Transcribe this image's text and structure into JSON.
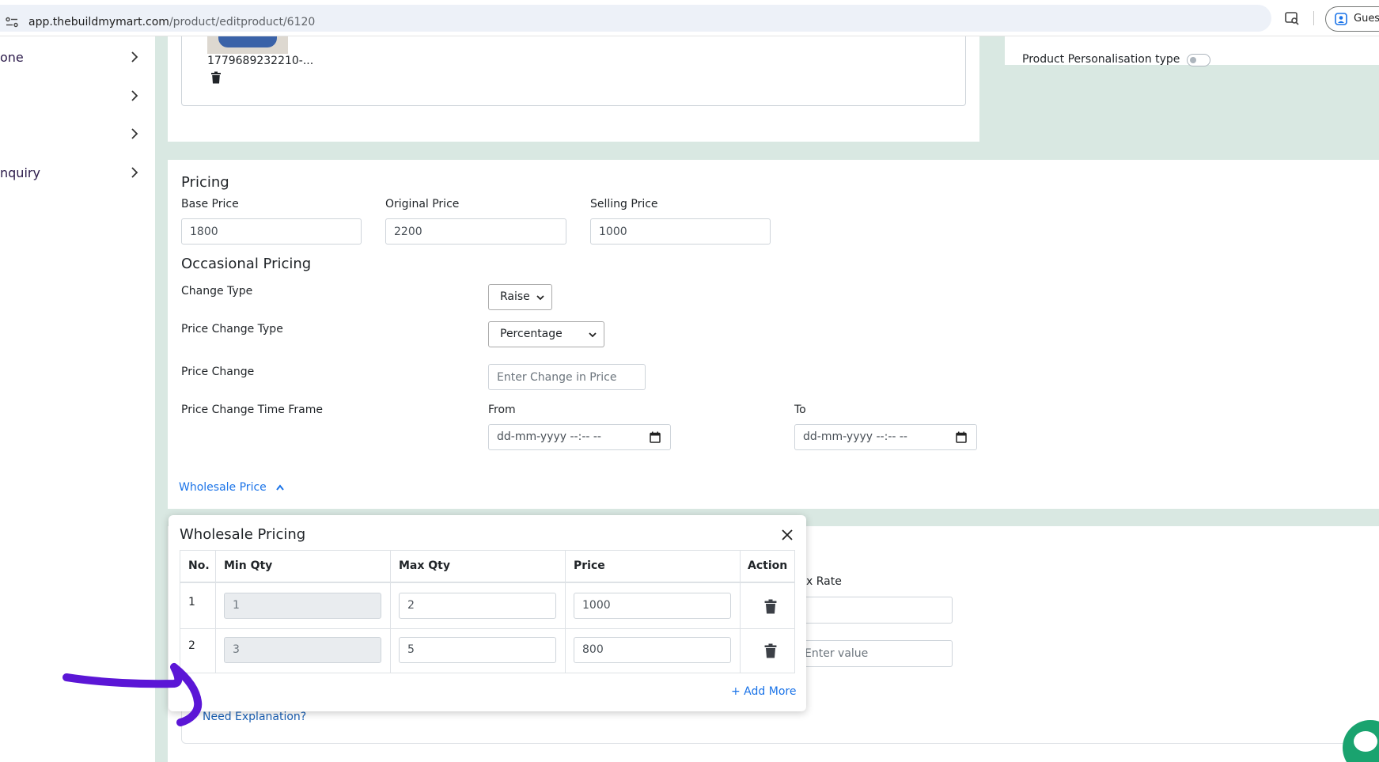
{
  "browser": {
    "url_host": "app.thebuildmymart.com",
    "url_path": "/product/editproduct/6120",
    "profile_label": "Guest"
  },
  "sidebar": {
    "items": [
      {
        "label": "one"
      },
      {
        "label": ""
      },
      {
        "label": ""
      },
      {
        "label": "nquiry"
      }
    ]
  },
  "images": {
    "file_name": "1779689232210-..."
  },
  "personalisation": {
    "label": "Product Personalisation type",
    "enabled": false
  },
  "pricing": {
    "title": "Pricing",
    "base_price_label": "Base Price",
    "base_price": "1800",
    "original_price_label": "Original Price",
    "original_price": "2200",
    "selling_price_label": "Selling Price",
    "selling_price": "1000"
  },
  "occasional": {
    "title": "Occasional Pricing",
    "change_type_label": "Change Type",
    "change_type_value": "Raise",
    "price_change_type_label": "Price Change Type",
    "price_change_type_value": "Percentage",
    "price_change_label": "Price Change",
    "price_change_placeholder": "Enter Change in Price",
    "time_frame_label": "Price Change Time Frame",
    "from_label": "From",
    "to_label": "To",
    "from_value": "dd-mm-yyyy --:-- --",
    "to_value": "dd-mm-yyyy --:-- --"
  },
  "wholesale_toggle_label": "Wholesale Price",
  "tax": {
    "rate_label": "x Rate",
    "value_placeholder": "Enter value"
  },
  "need_explanation_label": "Need Explanation?",
  "modal": {
    "title": "Wholesale Pricing",
    "headers": {
      "no": "No.",
      "min_qty": "Min Qty",
      "max_qty": "Max Qty",
      "price": "Price",
      "action": "Action"
    },
    "rows": [
      {
        "no": "1",
        "min_qty": "1",
        "max_qty": "2",
        "price": "1000"
      },
      {
        "no": "2",
        "min_qty": "3",
        "max_qty": "5",
        "price": "800"
      }
    ],
    "add_more_label": "+ Add More"
  },
  "colors": {
    "page_bg": "#d9e8e2",
    "link_blue": "#1a73e8",
    "annotation_purple": "#5b16d6",
    "chat_green": "#1aa36f"
  }
}
